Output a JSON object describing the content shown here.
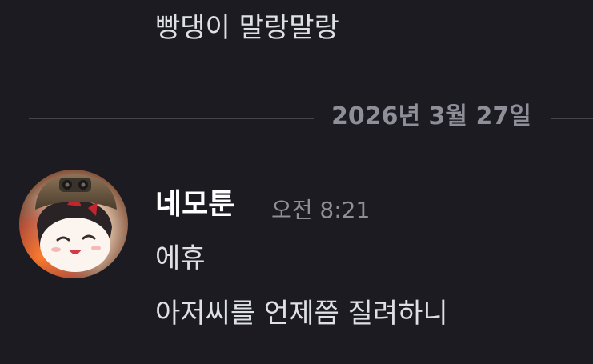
{
  "previous_message": {
    "text": "빵댕이 말랑말랑"
  },
  "date_divider": {
    "label": "2026년 3월 27일"
  },
  "message_group": {
    "author": "네모툰",
    "timestamp": "오전 8:21",
    "messages": [
      "에휴",
      "아저씨를 언제쯤 질려하니"
    ]
  },
  "icons": {
    "avatar": "user-avatar"
  }
}
